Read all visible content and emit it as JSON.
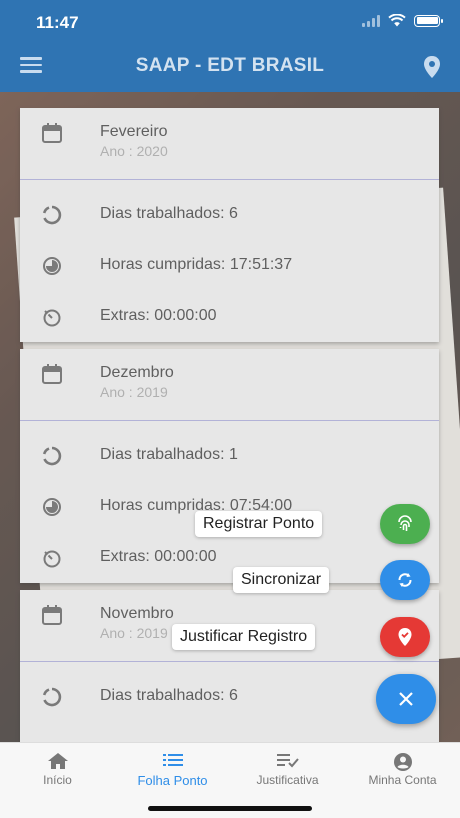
{
  "status": {
    "time": "11:47"
  },
  "header": {
    "title": "SAAP - EDT BRASIL"
  },
  "cards": [
    {
      "month": "Fevereiro",
      "year": "Ano : 2020",
      "dias": "Dias trabalhados: 6",
      "horas": "Horas cumpridas: 17:51:37",
      "extras": "Extras: 00:00:00"
    },
    {
      "month": "Dezembro",
      "year": "Ano : 2019",
      "dias": "Dias trabalhados: 1",
      "horas": "Horas cumpridas: 07:54:00",
      "extras": "Extras: 00:00:00"
    },
    {
      "month": "Novembro",
      "year": "Ano : 2019",
      "dias": "Dias trabalhados: 6"
    }
  ],
  "fab": {
    "registrar": "Registrar Ponto",
    "sincronizar": "Sincronizar",
    "justificar": "Justificar Registro"
  },
  "nav": {
    "inicio": "Início",
    "folha": "Folha Ponto",
    "justificativa": "Justificativa",
    "conta": "Minha Conta"
  },
  "colors": {
    "primary": "#2f74b3",
    "accent": "#2f8ee8",
    "fab_green": "#4caf50",
    "fab_blue": "#2f8ee8",
    "fab_red": "#e53935"
  }
}
